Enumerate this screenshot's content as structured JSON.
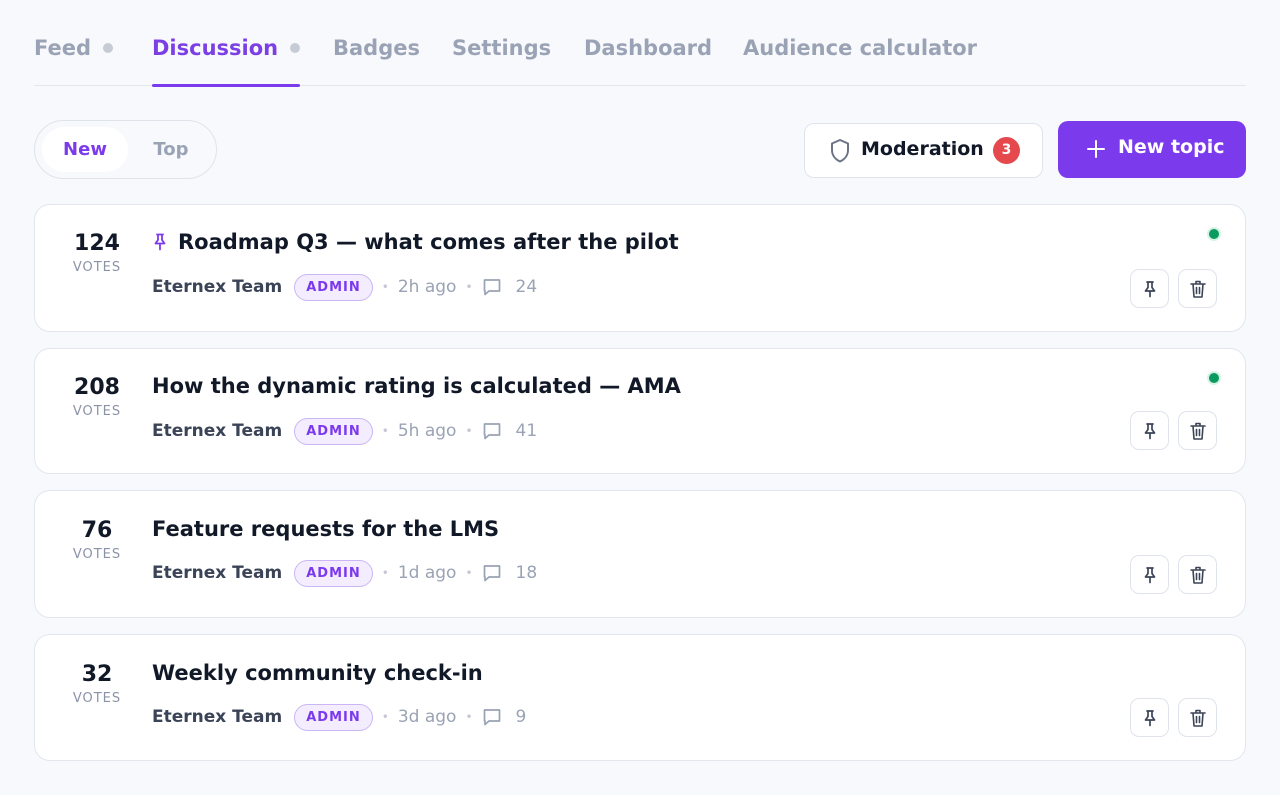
{
  "tabs": [
    {
      "label": "Feed",
      "has_dot": true,
      "active": false
    },
    {
      "label": "Discussion",
      "has_dot": true,
      "active": true
    },
    {
      "label": "Badges",
      "has_dot": false,
      "active": false
    },
    {
      "label": "Settings",
      "has_dot": false,
      "active": false
    },
    {
      "label": "Dashboard",
      "has_dot": false,
      "active": false
    },
    {
      "label": "Audience calculator",
      "has_dot": false,
      "active": false
    }
  ],
  "sort": {
    "options": [
      "New",
      "Top"
    ],
    "selected": "New"
  },
  "moderation": {
    "label": "Moderation",
    "count": "3",
    "icon": "shield-icon"
  },
  "new_topic": {
    "label": "New topic",
    "icon": "plus-icon"
  },
  "votes_unit": "VOTES",
  "topics": [
    {
      "votes": "124",
      "title": "Roadmap Q3 — what comes after the pilot",
      "pinned": true,
      "author": "Eternex Team",
      "role": "ADMIN",
      "time": "2h ago",
      "comments": "24",
      "online": true
    },
    {
      "votes": "208",
      "title": "How the dynamic rating is calculated — AMA",
      "pinned": false,
      "author": "Eternex Team",
      "role": "ADMIN",
      "time": "5h ago",
      "comments": "41",
      "online": true
    },
    {
      "votes": "76",
      "title": "Feature requests for the LMS",
      "pinned": false,
      "author": "Eternex Team",
      "role": "ADMIN",
      "time": "1d ago",
      "comments": "18",
      "online": false
    },
    {
      "votes": "32",
      "title": "Weekly community check-in",
      "pinned": false,
      "author": "Eternex Team",
      "role": "ADMIN",
      "time": "3d ago",
      "comments": "9",
      "online": false
    }
  ],
  "colors": {
    "accent": "#7c3aed",
    "badge": "#e5484d",
    "online": "#0a9a5f"
  }
}
